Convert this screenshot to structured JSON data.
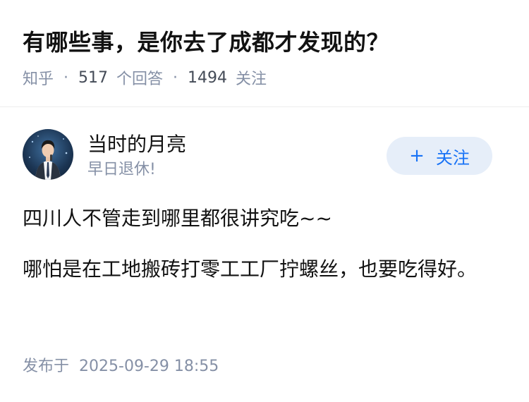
{
  "question": {
    "title": "有哪些事，是你去了成都才发现的？",
    "source": "知乎",
    "answer_count": "517",
    "answer_label": "个回答",
    "follower_count": "1494",
    "follower_label": "关注"
  },
  "answer": {
    "author_name": "当时的月亮",
    "author_bio": "早日退休!",
    "follow_button": {
      "icon": "+",
      "label": "关注"
    },
    "paragraphs": [
      "四川人不管走到哪里都很讲究吃~~",
      "哪怕是在工地搬砖打零工工厂拧螺丝，也要吃得好。"
    ],
    "published_label": "发布于",
    "published_time": "2025-09-29 18:55"
  },
  "colors": {
    "accent": "#1772f6",
    "follow_bg": "#e6eef9",
    "meta_gray": "#8590a6",
    "text": "#121212"
  }
}
